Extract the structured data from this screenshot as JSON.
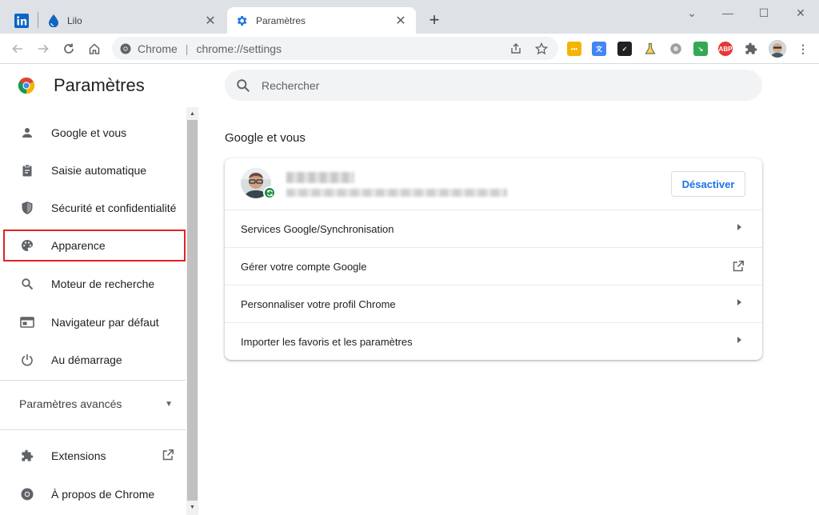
{
  "tabs": [
    {
      "title": "",
      "icon": "linkedin-icon"
    },
    {
      "title": "Lilo",
      "icon": "lilo-drop-icon"
    },
    {
      "title": "Paramètres",
      "icon": "gear-icon",
      "active": true
    }
  ],
  "omnibox": {
    "site": "Chrome",
    "url": "chrome://settings"
  },
  "sidebar": {
    "title": "Paramètres",
    "items": [
      {
        "label": "Google et vous",
        "icon": "person-icon"
      },
      {
        "label": "Saisie automatique",
        "icon": "clipboard-icon"
      },
      {
        "label": "Sécurité et confidentialité",
        "icon": "shield-icon"
      },
      {
        "label": "Apparence",
        "icon": "palette-icon"
      },
      {
        "label": "Moteur de recherche",
        "icon": "search-icon"
      },
      {
        "label": "Navigateur par défaut",
        "icon": "browser-icon"
      },
      {
        "label": "Au démarrage",
        "icon": "power-icon"
      }
    ],
    "advanced": "Paramètres avancés",
    "extensions": "Extensions",
    "about": "À propos de Chrome"
  },
  "search": {
    "placeholder": "Rechercher"
  },
  "section": {
    "title": "Google et vous"
  },
  "account": {
    "disable_label": "Désactiver"
  },
  "rows": [
    {
      "label": "Services Google/Synchronisation",
      "kind": "chevron"
    },
    {
      "label": "Gérer votre compte Google",
      "kind": "external"
    },
    {
      "label": "Personnaliser votre profil Chrome",
      "kind": "chevron"
    },
    {
      "label": "Importer les favoris et les paramètres",
      "kind": "chevron"
    }
  ],
  "extensions_toolbar": [
    "lastpass-icon",
    "translate-icon",
    "todo-check-icon",
    "flask-icon",
    "gear-ext-icon",
    "green-arrow-icon",
    "adblock-plus-icon",
    "puzzle-icon",
    "profile-avatar"
  ],
  "adblock_label": "ABP",
  "colors": {
    "accent": "#1a73e8",
    "highlight": "#e02424",
    "sync": "#1e8e3e"
  }
}
